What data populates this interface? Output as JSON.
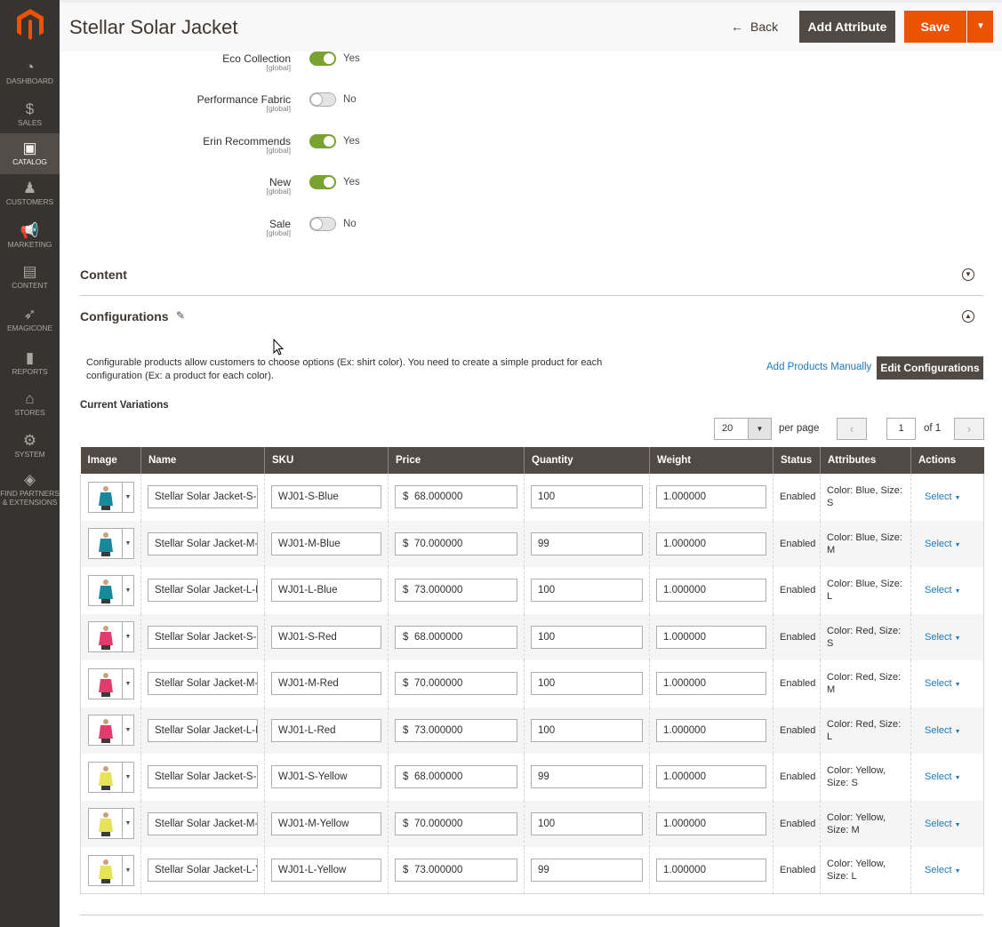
{
  "header": {
    "title": "Stellar Solar Jacket",
    "back_label": "Back",
    "add_attribute_label": "Add Attribute",
    "save_label": "Save"
  },
  "sidebar": {
    "items": [
      {
        "label": "DASHBOARD",
        "icon": "dashboard-icon"
      },
      {
        "label": "SALES",
        "icon": "dollar-icon"
      },
      {
        "label": "CATALOG",
        "icon": "box-icon",
        "active": true
      },
      {
        "label": "CUSTOMERS",
        "icon": "person-icon"
      },
      {
        "label": "MARKETING",
        "icon": "megaphone-icon"
      },
      {
        "label": "CONTENT",
        "icon": "layout-icon"
      },
      {
        "label": "EMAGICONE",
        "icon": "rocket-icon"
      },
      {
        "label": "REPORTS",
        "icon": "bar-chart-icon"
      },
      {
        "label": "STORES",
        "icon": "store-icon"
      },
      {
        "label": "SYSTEM",
        "icon": "gear-icon"
      },
      {
        "label": "FIND PARTNERS & EXTENSIONS",
        "icon": "cube-icon"
      }
    ]
  },
  "attributes": [
    {
      "label": "Eco Collection",
      "scope": "[global]",
      "on": true,
      "state": "Yes"
    },
    {
      "label": "Performance Fabric",
      "scope": "[global]",
      "on": false,
      "state": "No"
    },
    {
      "label": "Erin Recommends",
      "scope": "[global]",
      "on": true,
      "state": "Yes"
    },
    {
      "label": "New",
      "scope": "[global]",
      "on": true,
      "state": "Yes"
    },
    {
      "label": "Sale",
      "scope": "[global]",
      "on": false,
      "state": "No"
    }
  ],
  "sections": {
    "content_title": "Content",
    "configurations_title": "Configurations"
  },
  "configurations": {
    "description": "Configurable products allow customers to choose options (Ex: shirt color). You need to create a simple product for each configuration (Ex: a product for each color).",
    "add_manually_label": "Add Products Manually",
    "edit_label": "Edit Configurations",
    "current_variations_label": "Current Variations",
    "per_page_value": "20",
    "per_page_label": "per page",
    "page_value": "1",
    "page_of": "of 1"
  },
  "table": {
    "columns": [
      "Image",
      "Name",
      "SKU",
      "Price",
      "Quantity",
      "Weight",
      "Status",
      "Attributes",
      "Actions"
    ],
    "currency": "$",
    "action_label": "Select",
    "rows": [
      {
        "name": "Stellar Solar Jacket-S-Blue",
        "sku": "WJ01-S-Blue",
        "price": "68.000000",
        "qty": "100",
        "weight": "1.000000",
        "status": "Enabled",
        "attributes": "Color: Blue, Size: S",
        "color": "#16899a"
      },
      {
        "name": "Stellar Solar Jacket-M-Blue",
        "sku": "WJ01-M-Blue",
        "price": "70.000000",
        "qty": "99",
        "weight": "1.000000",
        "status": "Enabled",
        "attributes": "Color: Blue, Size: M",
        "color": "#16899a"
      },
      {
        "name": "Stellar Solar Jacket-L-Blue",
        "sku": "WJ01-L-Blue",
        "price": "73.000000",
        "qty": "100",
        "weight": "1.000000",
        "status": "Enabled",
        "attributes": "Color: Blue, Size: L",
        "color": "#16899a"
      },
      {
        "name": "Stellar Solar Jacket-S-Red",
        "sku": "WJ01-S-Red",
        "price": "68.000000",
        "qty": "100",
        "weight": "1.000000",
        "status": "Enabled",
        "attributes": "Color: Red, Size: S",
        "color": "#e23c6e"
      },
      {
        "name": "Stellar Solar Jacket-M-Red",
        "sku": "WJ01-M-Red",
        "price": "70.000000",
        "qty": "100",
        "weight": "1.000000",
        "status": "Enabled",
        "attributes": "Color: Red, Size: M",
        "color": "#e23c6e"
      },
      {
        "name": "Stellar Solar Jacket-L-Red",
        "sku": "WJ01-L-Red",
        "price": "73.000000",
        "qty": "100",
        "weight": "1.000000",
        "status": "Enabled",
        "attributes": "Color: Red, Size: L",
        "color": "#e23c6e"
      },
      {
        "name": "Stellar Solar Jacket-S-Yellow",
        "sku": "WJ01-S-Yellow",
        "price": "68.000000",
        "qty": "99",
        "weight": "1.000000",
        "status": "Enabled",
        "attributes": "Color: Yellow, Size: S",
        "color": "#e6e35a"
      },
      {
        "name": "Stellar Solar Jacket-M-Yellow",
        "sku": "WJ01-M-Yellow",
        "price": "70.000000",
        "qty": "100",
        "weight": "1.000000",
        "status": "Enabled",
        "attributes": "Color: Yellow, Size: M",
        "color": "#e6e35a"
      },
      {
        "name": "Stellar Solar Jacket-L-Yellow",
        "sku": "WJ01-L-Yellow",
        "price": "73.000000",
        "qty": "99",
        "weight": "1.000000",
        "status": "Enabled",
        "attributes": "Color: Yellow, Size: L",
        "color": "#e6e35a"
      }
    ]
  },
  "colors": {
    "accent": "#eb5202",
    "dark_button": "#514943",
    "toggle_on": "#79a22e",
    "link": "#1979c3",
    "sidebar_bg": "#373330"
  }
}
